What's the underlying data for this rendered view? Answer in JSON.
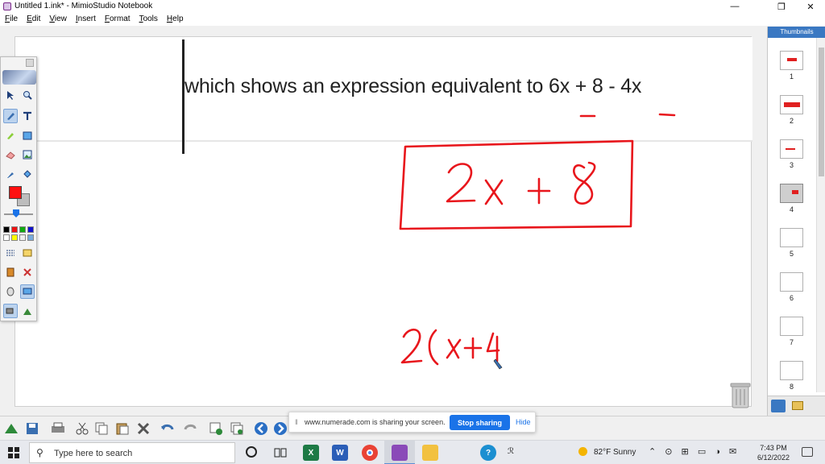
{
  "window": {
    "title": "Untitled 1.ink* - MimioStudio Notebook",
    "minimize_glyph": "—",
    "maximize_glyph": "❐",
    "close_glyph": "✕"
  },
  "menu": {
    "items": [
      {
        "underline": "F",
        "rest": "ile"
      },
      {
        "underline": "E",
        "rest": "dit"
      },
      {
        "underline": "V",
        "rest": "iew"
      },
      {
        "underline": "I",
        "rest": "nsert"
      },
      {
        "underline": "F",
        "rest": "ormat"
      },
      {
        "underline": "T",
        "rest": "ools"
      },
      {
        "underline": "H",
        "rest": "elp"
      }
    ]
  },
  "page": {
    "question_text": "which shows an expression equivalent to 6x + 8 - 4x"
  },
  "colors": {
    "ink": "#e8161c",
    "accent": "#1a73e8",
    "thumb_header": "#3a78c2"
  },
  "thumbnails": {
    "header": "Thumbnails",
    "pages": [
      "1",
      "2",
      "3",
      "4",
      "5",
      "6",
      "7",
      "8"
    ],
    "current": "4"
  },
  "share_banner": {
    "message": "www.numerade.com is sharing your screen.",
    "stop_label": "Stop sharing",
    "hide_label": "Hide"
  },
  "taskbar": {
    "search_placeholder": "Type here to search",
    "weather": "82°F  Sunny",
    "time": "7:43 PM",
    "date": "6/12/2022"
  }
}
